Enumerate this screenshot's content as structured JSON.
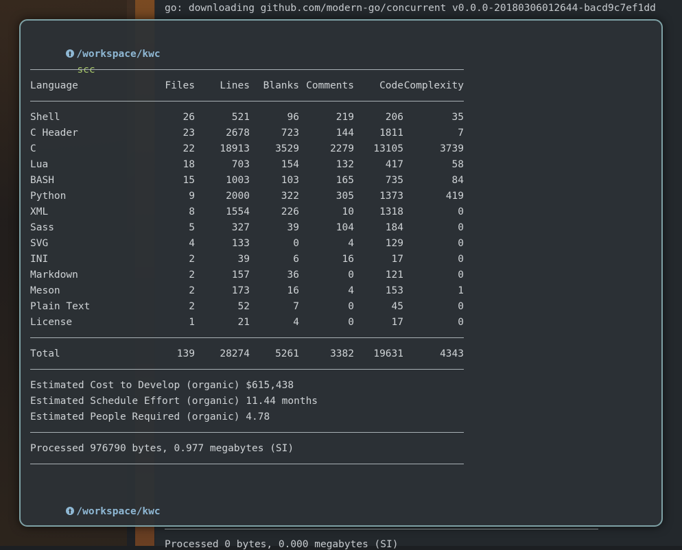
{
  "background_terminal": {
    "top_line": "go: downloading github.com/modern-go/concurrent v0.0.0-20180306012644-bacd9c7ef1dd",
    "bottom_line": "Processed 0 bytes, 0.000 megabytes (SI)"
  },
  "window": {
    "prompt_path": "/workspace/kwc",
    "command": "scc",
    "headers": {
      "language": "Language",
      "files": "Files",
      "lines": "Lines",
      "blanks": "Blanks",
      "comments": "Comments",
      "code": "Code",
      "complexity": "Complexity"
    },
    "rows": [
      {
        "language": "Shell",
        "files": "26",
        "lines": "521",
        "blanks": "96",
        "comments": "219",
        "code": "206",
        "complexity": "35"
      },
      {
        "language": "C Header",
        "files": "23",
        "lines": "2678",
        "blanks": "723",
        "comments": "144",
        "code": "1811",
        "complexity": "7"
      },
      {
        "language": "C",
        "files": "22",
        "lines": "18913",
        "blanks": "3529",
        "comments": "2279",
        "code": "13105",
        "complexity": "3739"
      },
      {
        "language": "Lua",
        "files": "18",
        "lines": "703",
        "blanks": "154",
        "comments": "132",
        "code": "417",
        "complexity": "58"
      },
      {
        "language": "BASH",
        "files": "15",
        "lines": "1003",
        "blanks": "103",
        "comments": "165",
        "code": "735",
        "complexity": "84"
      },
      {
        "language": "Python",
        "files": "9",
        "lines": "2000",
        "blanks": "322",
        "comments": "305",
        "code": "1373",
        "complexity": "419"
      },
      {
        "language": "XML",
        "files": "8",
        "lines": "1554",
        "blanks": "226",
        "comments": "10",
        "code": "1318",
        "complexity": "0"
      },
      {
        "language": "Sass",
        "files": "5",
        "lines": "327",
        "blanks": "39",
        "comments": "104",
        "code": "184",
        "complexity": "0"
      },
      {
        "language": "SVG",
        "files": "4",
        "lines": "133",
        "blanks": "0",
        "comments": "4",
        "code": "129",
        "complexity": "0"
      },
      {
        "language": "INI",
        "files": "2",
        "lines": "39",
        "blanks": "6",
        "comments": "16",
        "code": "17",
        "complexity": "0"
      },
      {
        "language": "Markdown",
        "files": "2",
        "lines": "157",
        "blanks": "36",
        "comments": "0",
        "code": "121",
        "complexity": "0"
      },
      {
        "language": "Meson",
        "files": "2",
        "lines": "173",
        "blanks": "16",
        "comments": "4",
        "code": "153",
        "complexity": "1"
      },
      {
        "language": "Plain Text",
        "files": "2",
        "lines": "52",
        "blanks": "7",
        "comments": "0",
        "code": "45",
        "complexity": "0"
      },
      {
        "language": "License",
        "files": "1",
        "lines": "21",
        "blanks": "4",
        "comments": "0",
        "code": "17",
        "complexity": "0"
      }
    ],
    "total": {
      "language": "Total",
      "files": "139",
      "lines": "28274",
      "blanks": "5261",
      "comments": "3382",
      "code": "19631",
      "complexity": "4343"
    },
    "estimates": {
      "cost": "Estimated Cost to Develop (organic) $615,438",
      "schedule": "Estimated Schedule Effort (organic) 11.44 months",
      "people": "Estimated People Required (organic) 4.78"
    },
    "processed": "Processed 976790 bytes, 0.977 megabytes (SI)"
  },
  "colors": {
    "window_border": "#7fa2a6",
    "prompt": "#8fb8d4",
    "command": "#a8c86a",
    "text": "#cfd3d6"
  }
}
